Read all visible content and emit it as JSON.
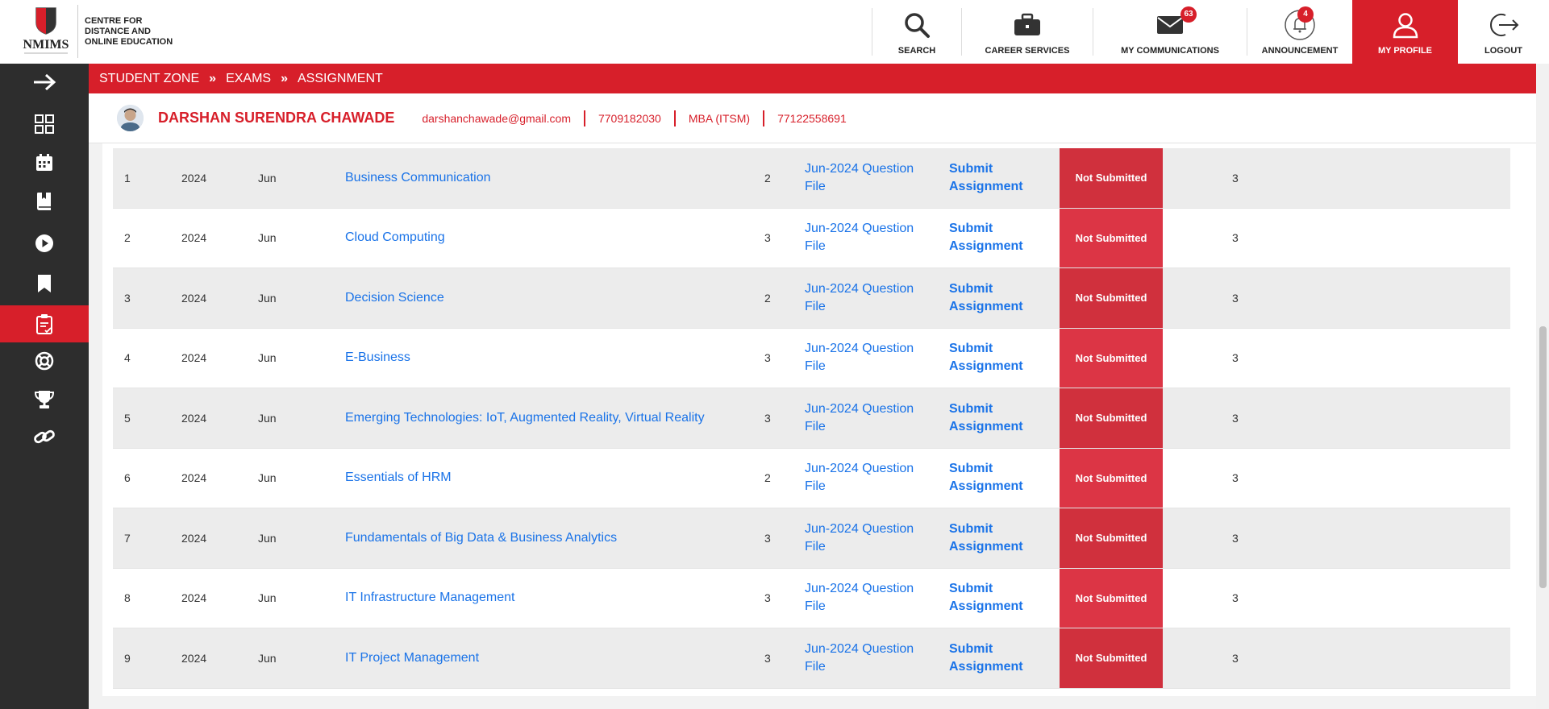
{
  "brand": {
    "logo_text": "NMIMS",
    "line1": "CENTRE FOR",
    "line2": "DISTANCE AND",
    "line3": "ONLINE EDUCATION"
  },
  "nav": [
    {
      "label": "SEARCH",
      "icon": "search-icon"
    },
    {
      "label": "CAREER SERVICES",
      "icon": "briefcase-icon"
    },
    {
      "label": "MY COMMUNICATIONS",
      "icon": "envelope-icon",
      "badge": "63"
    },
    {
      "label": "ANNOUNCEMENT",
      "icon": "bell-icon",
      "badge": "4"
    },
    {
      "label": "MY PROFILE",
      "icon": "user-icon"
    },
    {
      "label": "LOGOUT",
      "icon": "logout-icon"
    }
  ],
  "breadcrumb": [
    "STUDENT ZONE",
    "EXAMS",
    "ASSIGNMENT"
  ],
  "breadcrumb_sep": "»",
  "profile": {
    "name": "DARSHAN SURENDRA CHAWADE",
    "email": "darshanchawade@gmail.com",
    "phone": "7709182030",
    "program": "MBA (ITSM)",
    "student_id": "77122558691"
  },
  "sidebar": [
    "expand-arrow-icon",
    "dashboard-grid-icon",
    "calendar-icon",
    "book-icon",
    "play-icon",
    "bookmark-icon",
    "assignment-icon",
    "lifebuoy-icon",
    "trophy-icon",
    "link-icon"
  ],
  "colors": {
    "accent": "#d71f2a",
    "link": "#1a73e8",
    "sidebar": "#2d2d2d"
  },
  "rows": [
    {
      "no": "1",
      "year": "2024",
      "month": "Jun",
      "subject": "Business Communication",
      "credits": "2",
      "qf1": "Jun-2024 Question",
      "qf2": "File",
      "sa1": "Submit",
      "sa2": "Assignment",
      "status": "Not Submitted",
      "attempts": "3"
    },
    {
      "no": "2",
      "year": "2024",
      "month": "Jun",
      "subject": "Cloud Computing",
      "credits": "3",
      "qf1": "Jun-2024 Question",
      "qf2": "File",
      "sa1": "Submit",
      "sa2": "Assignment",
      "status": "Not Submitted",
      "attempts": "3"
    },
    {
      "no": "3",
      "year": "2024",
      "month": "Jun",
      "subject": "Decision Science",
      "credits": "2",
      "qf1": "Jun-2024 Question",
      "qf2": "File",
      "sa1": "Submit",
      "sa2": "Assignment",
      "status": "Not Submitted",
      "attempts": "3"
    },
    {
      "no": "4",
      "year": "2024",
      "month": "Jun",
      "subject": "E-Business",
      "credits": "3",
      "qf1": "Jun-2024 Question",
      "qf2": "File",
      "sa1": "Submit",
      "sa2": "Assignment",
      "status": "Not Submitted",
      "attempts": "3"
    },
    {
      "no": "5",
      "year": "2024",
      "month": "Jun",
      "subject": "Emerging Technologies: IoT, Augmented Reality, Virtual Reality",
      "credits": "3",
      "qf1": "Jun-2024 Question",
      "qf2": "File",
      "sa1": "Submit",
      "sa2": "Assignment",
      "status": "Not Submitted",
      "attempts": "3"
    },
    {
      "no": "6",
      "year": "2024",
      "month": "Jun",
      "subject": "Essentials of HRM",
      "credits": "2",
      "qf1": "Jun-2024 Question",
      "qf2": "File",
      "sa1": "Submit",
      "sa2": "Assignment",
      "status": "Not Submitted",
      "attempts": "3"
    },
    {
      "no": "7",
      "year": "2024",
      "month": "Jun",
      "subject": "Fundamentals of Big Data & Business Analytics",
      "credits": "3",
      "qf1": "Jun-2024 Question",
      "qf2": "File",
      "sa1": "Submit",
      "sa2": "Assignment",
      "status": "Not Submitted",
      "attempts": "3"
    },
    {
      "no": "8",
      "year": "2024",
      "month": "Jun",
      "subject": "IT Infrastructure Management",
      "credits": "3",
      "qf1": "Jun-2024 Question",
      "qf2": "File",
      "sa1": "Submit",
      "sa2": "Assignment",
      "status": "Not Submitted",
      "attempts": "3"
    },
    {
      "no": "9",
      "year": "2024",
      "month": "Jun",
      "subject": "IT Project Management",
      "credits": "3",
      "qf1": "Jun-2024 Question",
      "qf2": "File",
      "sa1": "Submit",
      "sa2": "Assignment",
      "status": "Not Submitted",
      "attempts": "3"
    }
  ]
}
